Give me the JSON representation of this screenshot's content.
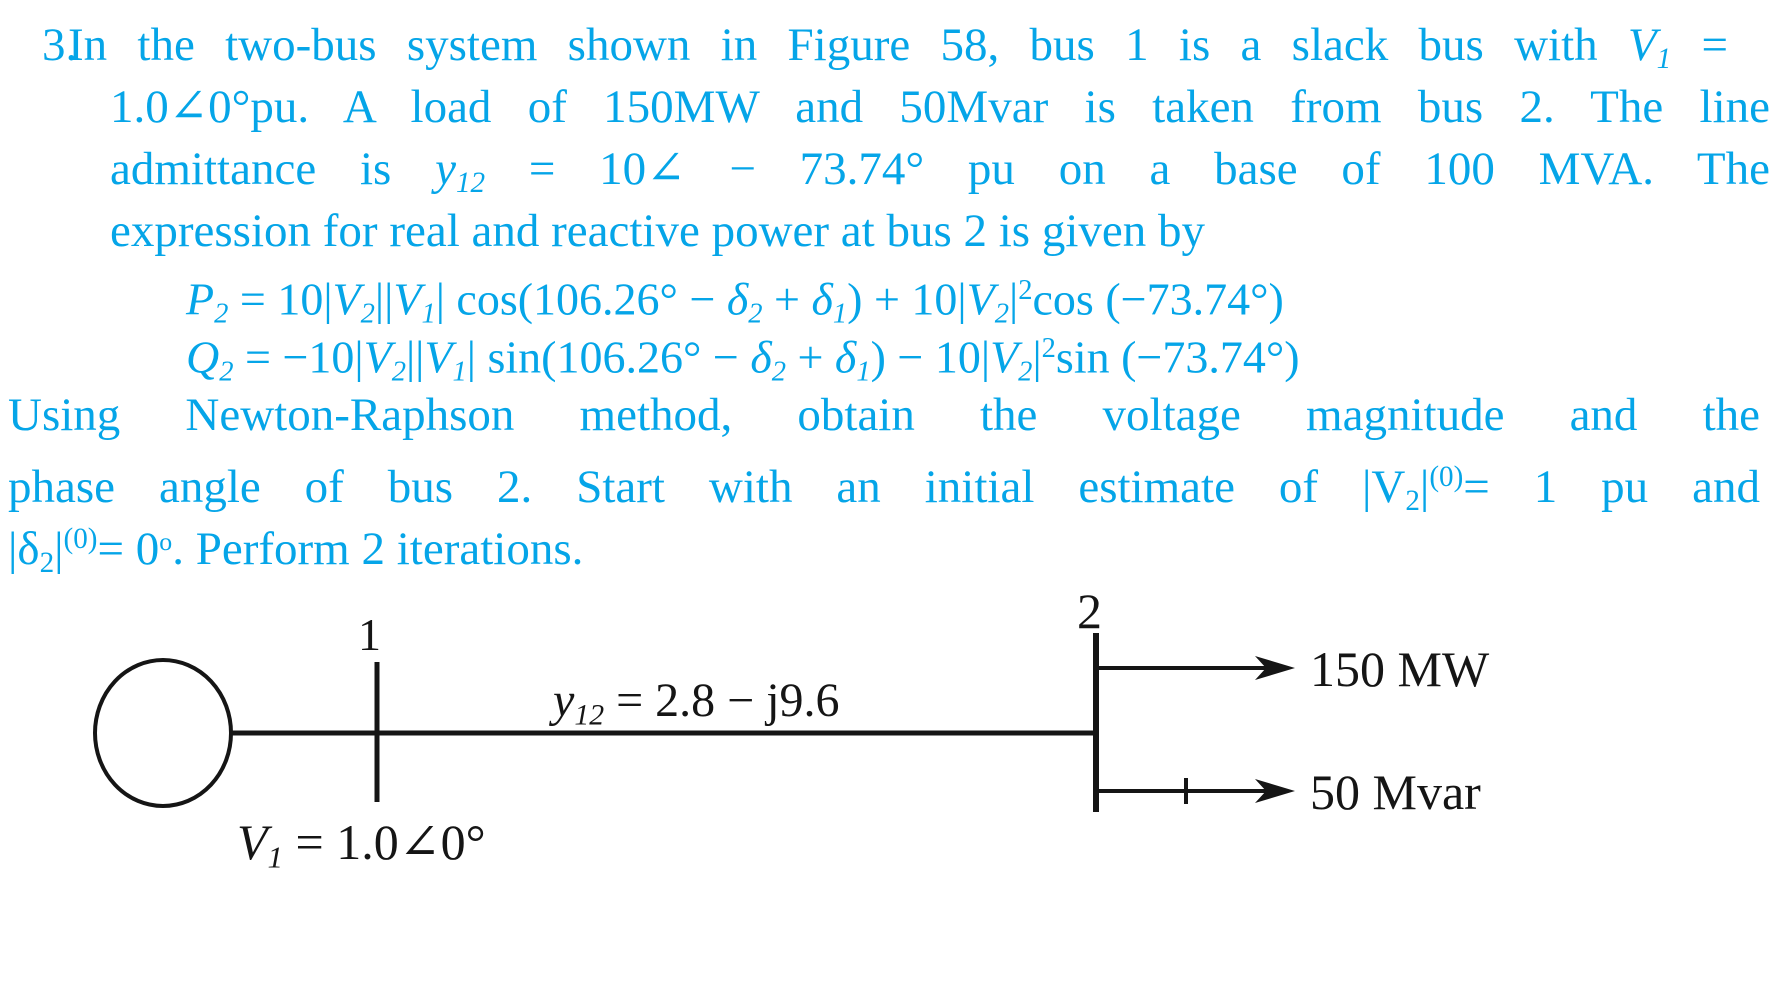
{
  "question": {
    "number": "3.",
    "line1_a": "In the two-bus system shown in Figure 58, bus 1 is a slack bus with ",
    "line1_v": "V",
    "line1_v_sub": "1",
    "line1_eq": " =",
    "line2": "1.0∠0°pu. A load of 150MW and 50Mvar is taken from bus 2. The line",
    "line3_a": "admittance is ",
    "line3_y": "y",
    "line3_y_sub": "12",
    "line3_b": " = 10∠ − 73.74° pu on a base of 100 MVA. The",
    "line4": "expression for real and reactive power at bus 2 is given by",
    "equation_P": "P₂ = 10|V₂||V₁| cos(106.26° − δ₂ + δ₁) + 10|V₂|²cos (−73.74°)",
    "equation_Q": "Q₂ = −10|V₂||V₁| sin(106.26° − δ₂ + δ₁) − 10|V₂|²sin (−73.74°)",
    "closing_line1": "Using Newton-Raphson method, obtain the voltage magnitude and the",
    "closing_line2_a": "phase angle of bus 2. Start with an initial estimate of |V",
    "closing_line2_sub": "2",
    "closing_line2_b": "|",
    "closing_line2_sup": "(0)",
    "closing_line2_c": "= 1 pu and",
    "closing_line3_a": "|δ",
    "closing_line3_sub": "2",
    "closing_line3_b": "|",
    "closing_line3_sup": "(0)",
    "closing_line3_c": "= 0",
    "closing_line3_deg": "o",
    "closing_line3_d": ". Perform 2 iterations."
  },
  "equation_parts": {
    "P_lhs_sym": "P",
    "P_lhs_sub": "2",
    "P_eq": " = 10|",
    "P_v2": "V",
    "P_v2_sub": "2",
    "P_mid1": "||",
    "P_v1": "V",
    "P_v1_sub": "1",
    "P_mid2": "| cos(106.26° − ",
    "P_d2": "δ",
    "P_d2_sub": "2",
    "P_plus": " + ",
    "P_d1": "δ",
    "P_d1_sub": "1",
    "P_tail1": ") + 10|",
    "P_v2b": "V",
    "P_v2b_sub": "2",
    "P_bar": "|",
    "P_sq": "2",
    "P_tail2": "cos (−73.74°)",
    "Q_lhs_sym": "Q",
    "Q_lhs_sub": "2",
    "Q_eq": " = −10|",
    "Q_mid2": "| sin(106.26° − ",
    "Q_tail1": ") − 10|",
    "Q_tail2": "sin (−73.74°)"
  },
  "figure": {
    "bus1_label": "1",
    "bus2_label": "2",
    "generator_voltage": "V",
    "generator_voltage_sub": "1",
    "generator_voltage_value": " = 1.0∠0°",
    "admittance_sym": "y",
    "admittance_sub": "12",
    "admittance_value": " = 2.8 − j9.6",
    "load_real": "150 MW",
    "load_reactive": "50 Mvar"
  },
  "colors": {
    "text_blue": "#05A5E8",
    "figure_black": "#1a1a1a",
    "background": "#ffffff"
  }
}
